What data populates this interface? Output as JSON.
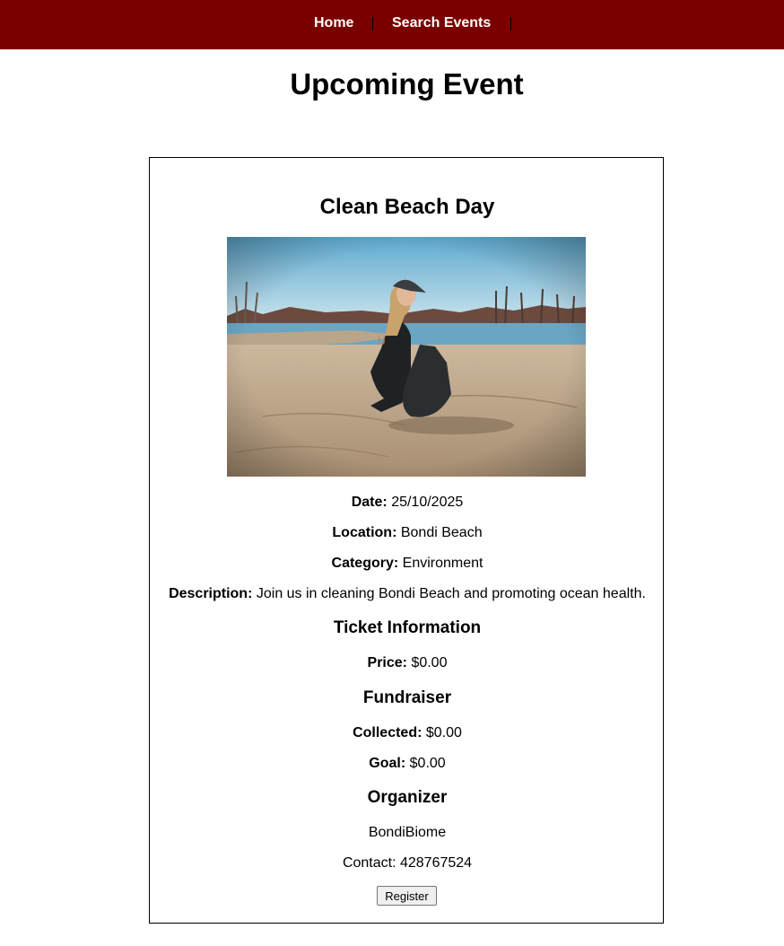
{
  "nav": {
    "home_label": "Home",
    "search_label": "Search Events",
    "bg_color": "#7a0000"
  },
  "page": {
    "title": "Upcoming Event"
  },
  "event": {
    "name": "Clean Beach Day",
    "image_alt": "Person collecting litter on a beach",
    "date_label": "Date:",
    "date_value": "25/10/2025",
    "location_label": "Location:",
    "location_value": "Bondi Beach",
    "category_label": "Category:",
    "category_value": "Environment",
    "description_label": "Description:",
    "description_value": "Join us in cleaning Bondi Beach and promoting ocean health.",
    "ticket_heading": "Ticket Information",
    "price_label": "Price:",
    "price_value": "$0.00",
    "fundraiser_heading": "Fundraiser",
    "collected_label": "Collected:",
    "collected_value": "$0.00",
    "goal_label": "Goal:",
    "goal_value": "$0.00",
    "organizer_heading": "Organizer",
    "organizer_name": "BondiBiome",
    "contact_text": "Contact: 428767524",
    "register_label": "Register"
  }
}
